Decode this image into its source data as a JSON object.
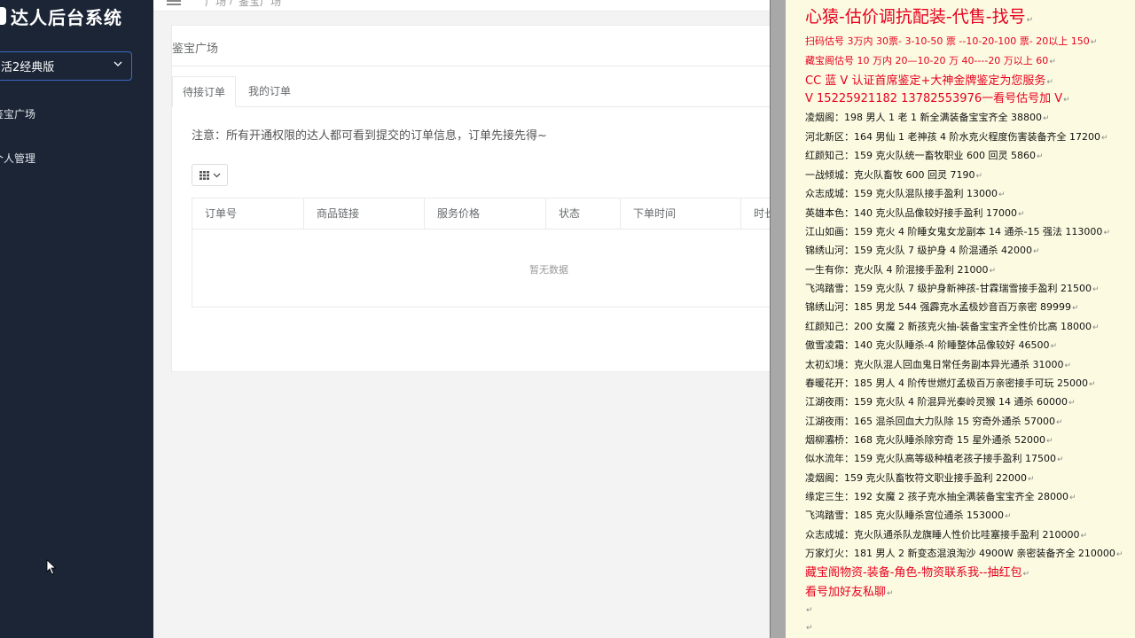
{
  "sidebar": {
    "brand": "达人后台系统",
    "version_select": "活2经典版",
    "items": [
      {
        "label": "鉴宝广场"
      },
      {
        "label": "个人管理"
      }
    ]
  },
  "breadcrumb": [
    "广场",
    "鉴宝广场"
  ],
  "panel": {
    "title": "鉴宝广场",
    "tabs": [
      {
        "label": "待接订单",
        "active": true
      },
      {
        "label": "我的订单",
        "active": false
      }
    ],
    "notice": "注意：所有开通权限的达人都可看到提交的订单信息，订单先接先得~",
    "table": {
      "columns": [
        "订单号",
        "商品链接",
        "服务价格",
        "状态",
        "下单时间",
        "时长"
      ],
      "empty_text": "暂无数据"
    }
  },
  "note": {
    "lines": [
      {
        "text": "心猿-估价调抗配装-代售-找号",
        "style": "red big"
      },
      {
        "text": "扫码估号 3万内 30票- 3-10-50 票  --10-20-100 票- 20以上 150",
        "style": "red r1"
      },
      {
        "text": "藏宝阁估号 10 万内 20—10-20 万 40----20 万以上 60",
        "style": "red r1"
      },
      {
        "text": "CC 蓝 V 认证首席鉴定+大神金牌鉴定为您服务",
        "style": "red med"
      },
      {
        "text": "V 15225921182     13782553976一看号估号加 V",
        "style": "red med"
      },
      {
        "text": "凌烟阁：198 男人 1 老 1 新全满装备宝宝齐全 38800",
        "style": ""
      },
      {
        "text": "河北新区：164 男仙 1 老神孩 4 阶水克火程度伤害装备齐全 17200",
        "style": ""
      },
      {
        "text": "红颜知己：159 克火队统一畜牧职业 600 回灵 5860",
        "style": ""
      },
      {
        "text": "一战倾城：克火队畜牧 600 回灵 7190",
        "style": ""
      },
      {
        "text": "众志成城：159 克火队混队接手盈利 13000",
        "style": ""
      },
      {
        "text": "英雄本色：140 克火队品像较好接手盈利 17000",
        "style": ""
      },
      {
        "text": "江山如画：159 克火 4 阶睡女鬼女龙副本 14 通杀-15 强法 113000",
        "style": ""
      },
      {
        "text": "锦绣山河：159 克火队 7 级护身 4 阶混通杀 42000",
        "style": ""
      },
      {
        "text": "一生有你：克火队 4 阶混接手盈利 21000",
        "style": ""
      },
      {
        "text": "飞鸿踏雪：159 克火队 7 级护身新神孩-甘霖瑞雪接手盈利 21500",
        "style": ""
      },
      {
        "text": "锦绣山河：185 男龙 544 强霹克水孟极妙音百万亲密 89999",
        "style": ""
      },
      {
        "text": "红颜知己：200 女魔 2 新孩克火抽-装备宝宝齐全性价比高 18000",
        "style": ""
      },
      {
        "text": "傲雪凌霜：140 克火队睡杀-4 阶睡整体品像较好 46500",
        "style": ""
      },
      {
        "text": "太初幻境：克火队混人回血鬼日常任务副本异光通杀 31000",
        "style": ""
      },
      {
        "text": "春暖花开：185 男人 4 阶传世燃灯孟极百万亲密接手可玩 25000",
        "style": ""
      },
      {
        "text": "江湖夜雨：159 克火队 4 阶混异光秦岭灵猴 14 通杀 60000",
        "style": ""
      },
      {
        "text": "江湖夜雨：165 混杀回血大力队除 15 穷奇外通杀 57000",
        "style": ""
      },
      {
        "text": "烟柳灞桥：168 克火队睡杀除穷奇 15 星外通杀 52000",
        "style": ""
      },
      {
        "text": "似水流年：159 克火队高等级种植老孩子接手盈利 17500",
        "style": ""
      },
      {
        "text": "凌烟阁：159 克火队畜牧符文职业接手盈利 22000",
        "style": ""
      },
      {
        "text": "缘定三生：192 女魔 2 孩子克水抽全满装备宝宝齐全 28000",
        "style": ""
      },
      {
        "text": "飞鸿踏雪：185 克火队睡杀宫位通杀 153000",
        "style": ""
      },
      {
        "text": "众志成城：克火队通杀队龙旗睡人性价比哇塞接手盈利 210000",
        "style": ""
      },
      {
        "text": "万家灯火：181 男人 2 新变态混浪淘沙 4900W 亲密装备齐全 210000",
        "style": ""
      },
      {
        "text": "藏宝阁物资-装备-角色-物资联系我--抽红包",
        "style": "red med"
      },
      {
        "text": "看号加好友私聊",
        "style": "red med"
      },
      {
        "text": "",
        "style": ""
      },
      {
        "text": "",
        "style": ""
      }
    ]
  },
  "colors": {
    "sidebar_bg": "#1b2536",
    "accent_border": "#3d6cc4",
    "note_bg": "#fcfbe2",
    "note_red": "#e6001e"
  }
}
